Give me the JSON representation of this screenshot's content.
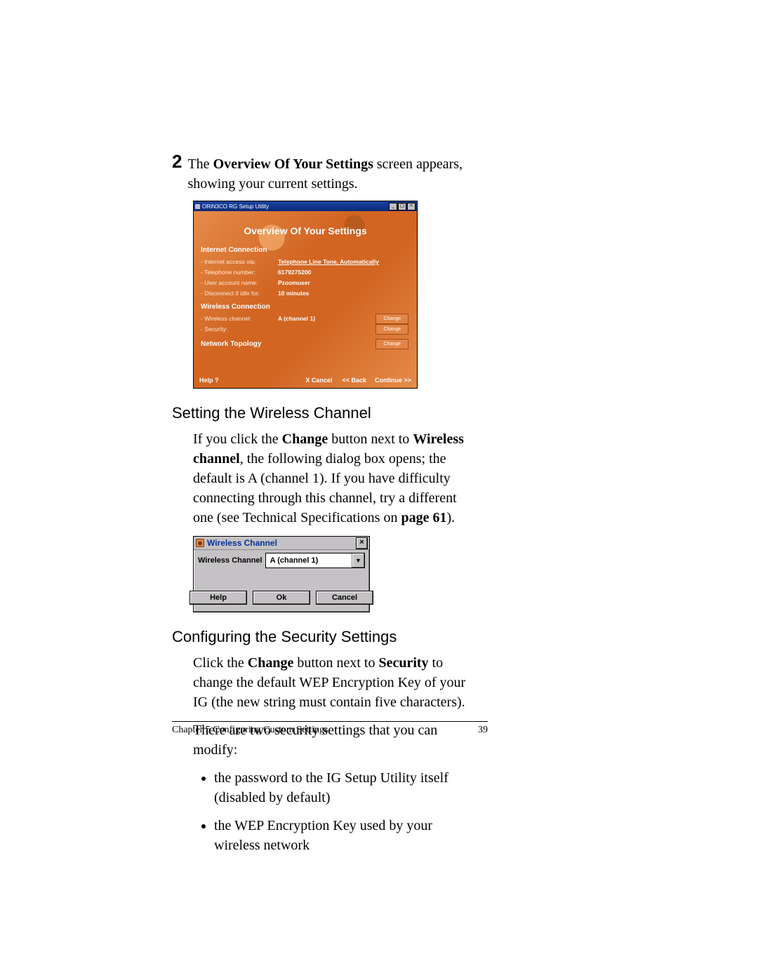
{
  "step2": {
    "number": "2",
    "text_pre": "The ",
    "bold": "Overview Of Your Settings",
    "text_post": " screen appears, showing your current settings."
  },
  "overview": {
    "window_title": "ORiN3CO RG Setup Utility",
    "heading": "Overview Of Your Settings",
    "sections": {
      "internet": {
        "title": "Internet Connection",
        "rows": [
          {
            "label": "Internet access via:",
            "value": "Telephone Line Tone, Automatically"
          },
          {
            "label": "Telephone number:",
            "value": "6179275200"
          },
          {
            "label": "User account name:",
            "value": "Pzoomuser"
          },
          {
            "label": "Disconnect if idle for:",
            "value": "10 minutes"
          }
        ]
      },
      "wireless": {
        "title": "Wireless Connection",
        "rows": [
          {
            "label": "Wireless channel:",
            "value": "A (channel 1)",
            "change": "Change"
          },
          {
            "label": "Security:",
            "value": "",
            "change": "Change"
          }
        ]
      },
      "topology": {
        "title": "Network Topology",
        "change": "Change"
      }
    },
    "footer": {
      "help": "Help ?",
      "cancel": "X Cancel",
      "back": "<< Back",
      "continue": "Continue >>"
    }
  },
  "sec_wireless": {
    "heading": "Setting the Wireless Channel",
    "p1_a": "If you click the ",
    "p1_b1": "Change",
    "p1_c": " button next to ",
    "p1_b2": "Wireless channel",
    "p1_d": ", the following dialog box opens; the default is A (channel 1). If you have difficulty connecting through this channel, try a different one (see Technical Specifications on ",
    "p1_b3": "page 61",
    "p1_e": ")."
  },
  "wc_dialog": {
    "title": "Wireless Channel",
    "label": "Wireless Channel",
    "selected": "A (channel 1)",
    "buttons": {
      "help": "Help",
      "ok": "Ok",
      "cancel": "Cancel"
    }
  },
  "sec_security": {
    "heading": "Configuring the Security Settings",
    "p1_a": "Click the ",
    "p1_b1": "Change",
    "p1_c": " button next to ",
    "p1_b2": "Security",
    "p1_d": " to change the default WEP Encryption Key of your IG (the new string must contain five characters).",
    "p2": "There are two security settings that you can modify:",
    "bullets": [
      "the password to the IG Setup Utility itself (disabled by default)",
      "the WEP Encryption Key used by your wireless network"
    ]
  },
  "pagefoot": {
    "left": "Chapter 5    Configuring Custom Settings",
    "right": "39"
  }
}
